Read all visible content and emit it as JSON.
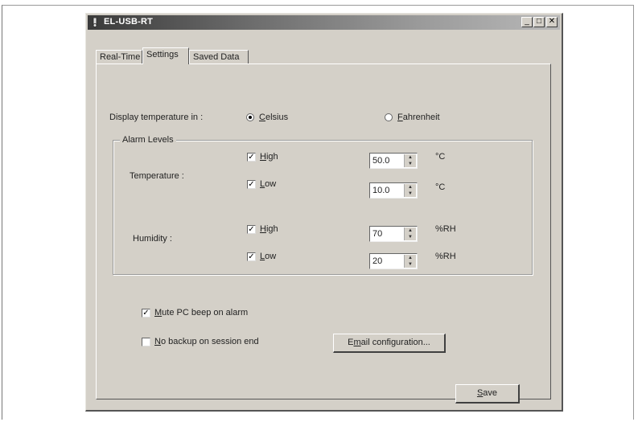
{
  "window": {
    "title": "EL-USB-RT",
    "minimize": "_",
    "maximize": "□",
    "close": "✕"
  },
  "tabs": [
    {
      "label": "Real-Time"
    },
    {
      "label": "Settings"
    },
    {
      "label": "Saved Data"
    }
  ],
  "display": {
    "label": "Display temperature in :",
    "celsius": {
      "first": "C",
      "rest": "elsius",
      "selected": true
    },
    "fahrenheit": {
      "first": "F",
      "rest": "ahrenheit",
      "selected": false
    }
  },
  "alarm": {
    "legend": "Alarm Levels",
    "temperature": {
      "label": "Temperature :",
      "high": {
        "checked": true,
        "first": "H",
        "rest": "igh",
        "value": "50.0",
        "unit": "°C"
      },
      "low": {
        "checked": true,
        "first": "L",
        "rest": "ow",
        "value": "10.0",
        "unit": "°C"
      }
    },
    "humidity": {
      "label": "Humidity :",
      "high": {
        "checked": true,
        "first": "H",
        "rest": "igh",
        "value": "70",
        "unit": "%RH"
      },
      "low": {
        "checked": true,
        "first": "L",
        "rest": "ow",
        "value": "20",
        "unit": "%RH"
      }
    }
  },
  "options": {
    "mute": {
      "checked": true,
      "first": "M",
      "rest": "ute PC beep on alarm"
    },
    "no_backup": {
      "checked": false,
      "first": "N",
      "rest": "o backup on session end"
    }
  },
  "buttons": {
    "email": {
      "pre": "E",
      "ul": "m",
      "post": "ail configuration..."
    },
    "save": {
      "first": "S",
      "rest": "ave"
    }
  },
  "icons": {
    "check": "✓",
    "up": "▲",
    "down": "▼"
  }
}
